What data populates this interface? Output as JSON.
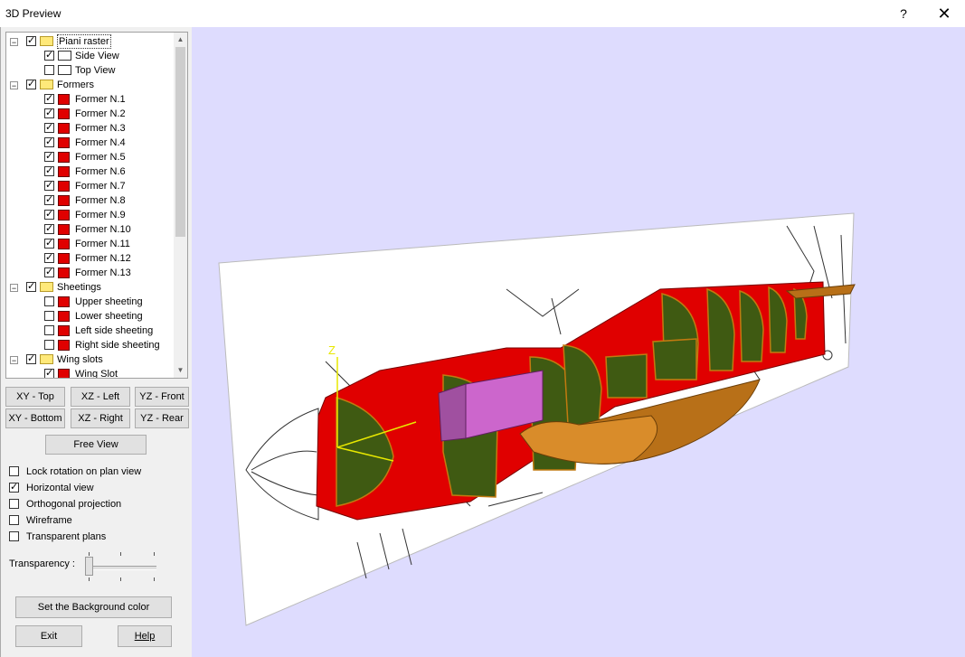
{
  "window": {
    "title": "3D Preview",
    "help_glyph": "?",
    "close_glyph": "✕"
  },
  "tree": {
    "rows": [
      {
        "label": "Piani raster",
        "level": 0,
        "expander": "−",
        "checked": true,
        "icon": "folder-icon",
        "selected": true
      },
      {
        "label": "Side View",
        "level": 1,
        "checked": true,
        "icon": "raster-icon"
      },
      {
        "label": "Top View",
        "level": 1,
        "checked": false,
        "icon": "raster-icon"
      },
      {
        "label": "Formers",
        "level": 0,
        "expander": "−",
        "checked": true,
        "icon": "folder-icon"
      },
      {
        "label": "Former N.1",
        "level": 1,
        "checked": true,
        "icon": "cube-icon"
      },
      {
        "label": "Former N.2",
        "level": 1,
        "checked": true,
        "icon": "cube-icon"
      },
      {
        "label": "Former N.3",
        "level": 1,
        "checked": true,
        "icon": "cube-icon"
      },
      {
        "label": "Former N.4",
        "level": 1,
        "checked": true,
        "icon": "cube-icon"
      },
      {
        "label": "Former N.5",
        "level": 1,
        "checked": true,
        "icon": "cube-icon"
      },
      {
        "label": "Former N.6",
        "level": 1,
        "checked": true,
        "icon": "cube-icon"
      },
      {
        "label": "Former N.7",
        "level": 1,
        "checked": true,
        "icon": "cube-icon"
      },
      {
        "label": "Former N.8",
        "level": 1,
        "checked": true,
        "icon": "cube-icon"
      },
      {
        "label": "Former N.9",
        "level": 1,
        "checked": true,
        "icon": "cube-icon"
      },
      {
        "label": "Former N.10",
        "level": 1,
        "checked": true,
        "icon": "cube-icon"
      },
      {
        "label": "Former N.11",
        "level": 1,
        "checked": true,
        "icon": "cube-icon"
      },
      {
        "label": "Former N.12",
        "level": 1,
        "checked": true,
        "icon": "cube-icon"
      },
      {
        "label": "Former N.13",
        "level": 1,
        "checked": true,
        "icon": "cube-icon"
      },
      {
        "label": "Sheetings",
        "level": 0,
        "expander": "−",
        "checked": true,
        "icon": "folder-icon"
      },
      {
        "label": "Upper sheeting",
        "level": 1,
        "checked": false,
        "icon": "cube-icon"
      },
      {
        "label": "Lower sheeting",
        "level": 1,
        "checked": false,
        "icon": "cube-icon"
      },
      {
        "label": "Left side sheeting",
        "level": 1,
        "checked": false,
        "icon": "cube-icon"
      },
      {
        "label": "Right side sheeting",
        "level": 1,
        "checked": false,
        "icon": "cube-icon"
      },
      {
        "label": "Wing slots",
        "level": 0,
        "expander": "−",
        "checked": true,
        "icon": "folder-icon"
      },
      {
        "label": "Wing Slot",
        "level": 1,
        "checked": true,
        "icon": "cube-icon"
      }
    ]
  },
  "view_buttons": {
    "xy_top": "XY - Top",
    "xz_left": "XZ - Left",
    "yz_front": "YZ - Front",
    "xy_bottom": "XY - Bottom",
    "xz_right": "XZ - Right",
    "yz_rear": "YZ - Rear",
    "free_view": "Free View"
  },
  "options": [
    {
      "label": "Lock rotation on plan view",
      "checked": false
    },
    {
      "label": "Horizontal view",
      "checked": true
    },
    {
      "label": "Orthogonal projection",
      "checked": false
    },
    {
      "label": "Wireframe",
      "checked": false
    },
    {
      "label": "Transparent plans",
      "checked": false
    }
  ],
  "transparency": {
    "label": "Transparency :",
    "value": 0.0
  },
  "buttons": {
    "background_color": "Set the Background color",
    "exit": "Exit",
    "help": "Help"
  },
  "viewport": {
    "background": "#dedcfe",
    "axis_label": "Z",
    "colors": {
      "fuselage": "#e00000",
      "former": "#3f5a12",
      "wing": "#b87018",
      "block": "#a050a0"
    }
  }
}
